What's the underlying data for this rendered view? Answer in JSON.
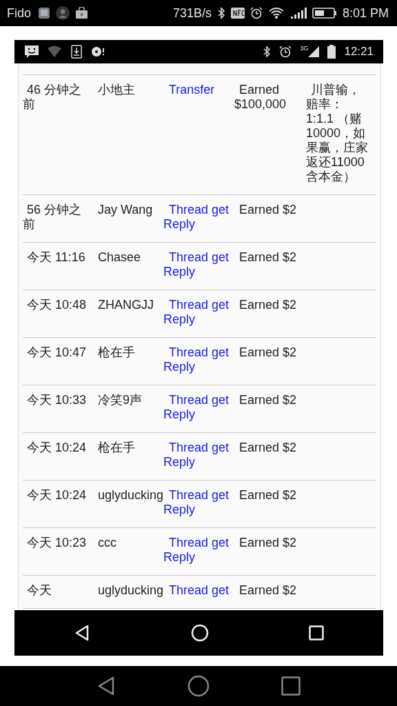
{
  "outer_status_bar": {
    "carrier": "Fido",
    "speed": "731B/s",
    "time": "8:01 PM"
  },
  "inner_status_bar": {
    "network": "3G",
    "time": "12:21"
  },
  "rows": [
    {
      "time": "46 分钟之前",
      "user": "小地主",
      "action": "Transfer",
      "amount": "Earned $100,000",
      "note": "川普输，赔率：1:1.1 （赌10000，如果赢，庄家返还11000含本金）"
    },
    {
      "time": "56 分钟之前",
      "user": "Jay Wang",
      "action": "Thread get Reply",
      "amount": "Earned $2"
    },
    {
      "time": "今天 11:16",
      "user": "Chasee",
      "action": "Thread get Reply",
      "amount": "Earned $2"
    },
    {
      "time": "今天 10:48",
      "user": "ZHANGJJ",
      "action": "Thread get Reply",
      "amount": "Earned $2"
    },
    {
      "time": "今天 10:47",
      "user": "枪在手",
      "action": "Thread get Reply",
      "amount": "Earned $2"
    },
    {
      "time": "今天 10:33",
      "user": "冷笑9声",
      "action": "Thread get Reply",
      "amount": "Earned $2"
    },
    {
      "time": "今天 10:24",
      "user": "枪在手",
      "action": "Thread get Reply",
      "amount": "Earned $2"
    },
    {
      "time": "今天 10:24",
      "user": "uglyducking",
      "action": "Thread get Reply",
      "amount": "Earned $2"
    },
    {
      "time": "今天 10:23",
      "user": "ccc",
      "action": "Thread get Reply",
      "amount": "Earned $2"
    },
    {
      "time": "今天",
      "user": "uglyducking",
      "action": "Thread get",
      "amount": "Earned $2"
    }
  ]
}
